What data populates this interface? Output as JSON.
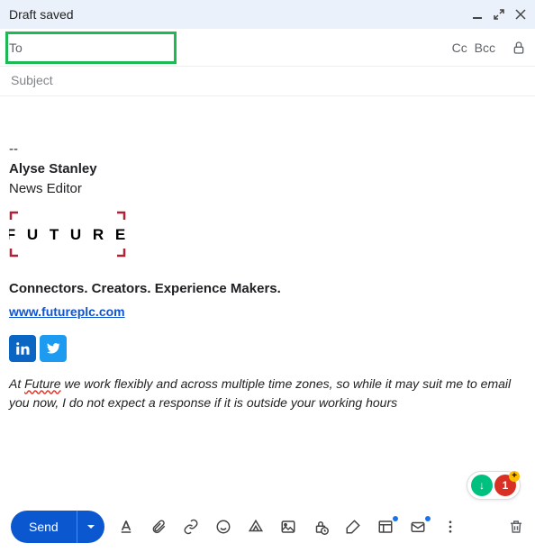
{
  "header": {
    "title": "Draft saved"
  },
  "recipients": {
    "to_label": "To",
    "cc_label": "Cc",
    "bcc_label": "Bcc"
  },
  "subject": {
    "placeholder": "Subject",
    "value": ""
  },
  "signature": {
    "separator": "--",
    "name": "Alyse Stanley",
    "role": "News Editor",
    "company_logo_text": "F U T U R E",
    "tagline": "Connectors. Creators. Experience Makers.",
    "website": "www.futureplc.com",
    "note_prefix": "At ",
    "note_spell": "Future",
    "note_rest": " we work flexibly and across multiple time zones, so while it may suit me to email you now, I do not expect a response if it is outside your working hours"
  },
  "extensions": {
    "badge1": "↓",
    "badge2": "1"
  },
  "footer": {
    "send_label": "Send"
  }
}
